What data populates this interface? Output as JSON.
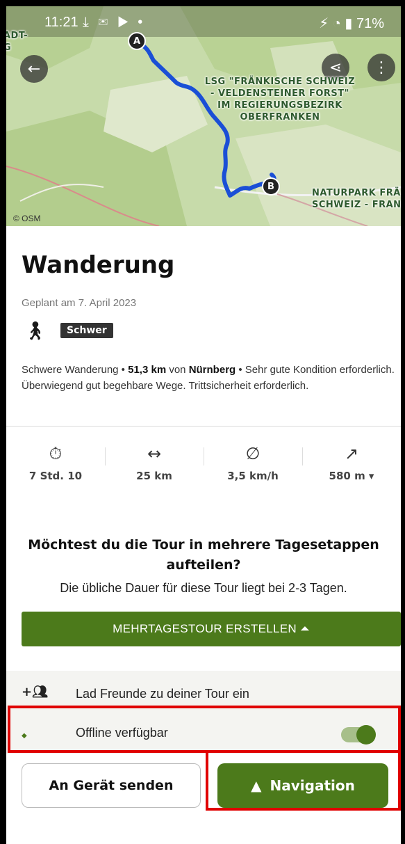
{
  "status_bar": {
    "time": "11:21",
    "left_icons": "⤓ ✉ ▶ •",
    "battery": "71%"
  },
  "map": {
    "top_left_fragment": "ADT-\nG",
    "label_1": "LSG \"FRÄNKISCHE SCHWEIZ\n- VELDENSTEINER FORST\"\nIM REGIERUNGSBEZIRK\nOBERFRANKEN",
    "label_2": "NATURPARK FRÄ\nSCHWEIZ - FRAN",
    "marker_start": "A",
    "marker_end": "B",
    "attribution": "© OSM",
    "route_color": "#1a4fd6"
  },
  "tour": {
    "title": "Wanderung",
    "planned": "Geplant am 7. April 2023",
    "difficulty": "Schwer",
    "desc_part1": "Schwere Wanderung • ",
    "desc_distance": "51,3 km",
    "desc_part2": " von ",
    "desc_city": "Nürnberg",
    "desc_part3": " • Sehr gute Kondition erforderlich. Überwiegend gut begehbare Wege. Trittsicherheit erforderlich."
  },
  "stats": {
    "duration": "7 Std. 10",
    "distance": "25 km",
    "speed": "3,5 km/h",
    "elevation": "580 m ▾"
  },
  "multiday": {
    "question": "Möchtest du die Tour in mehrere Tagesetappen aufteilen?",
    "info": "Die übliche Dauer für diese Tour liegt bei 2-3 Tagen.",
    "button": "MEHRTAGESTOUR ERSTELLEN ⏶"
  },
  "invite": {
    "label": "Lad Freunde zu deiner Tour ein"
  },
  "offline": {
    "label": "Offline verfügbar",
    "enabled": true
  },
  "actions": {
    "send": "An Gerät senden",
    "navigation": "Navigation"
  },
  "colors": {
    "brand_green": "#4c7a1b",
    "highlight_red": "#e00000"
  }
}
